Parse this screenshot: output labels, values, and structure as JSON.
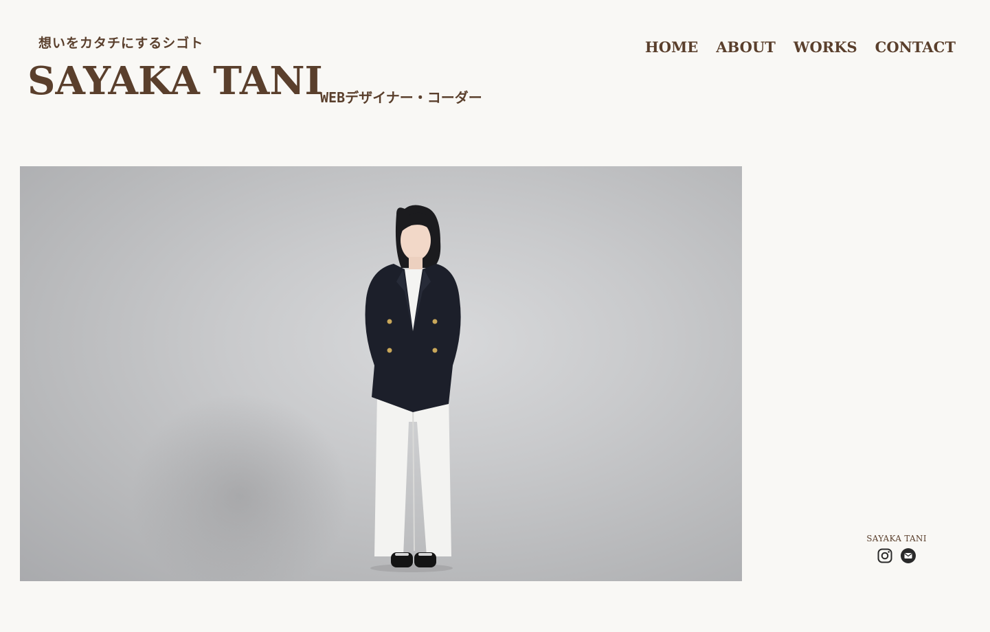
{
  "header": {
    "tagline": "想いをカタチにするシゴト",
    "brand_name": "SAYAKA TANI",
    "role": "WEBデザイナー・コーダー"
  },
  "nav": {
    "items": [
      {
        "label": "HOME"
      },
      {
        "label": "ABOUT"
      },
      {
        "label": "WORKS"
      },
      {
        "label": "CONTACT"
      }
    ]
  },
  "footer": {
    "name": "SAYAKA TANI",
    "social": [
      {
        "icon": "instagram-icon"
      },
      {
        "icon": "mail-icon"
      }
    ]
  },
  "colors": {
    "background": "#f9f8f5",
    "brand_brown": "#5a3f2c"
  }
}
